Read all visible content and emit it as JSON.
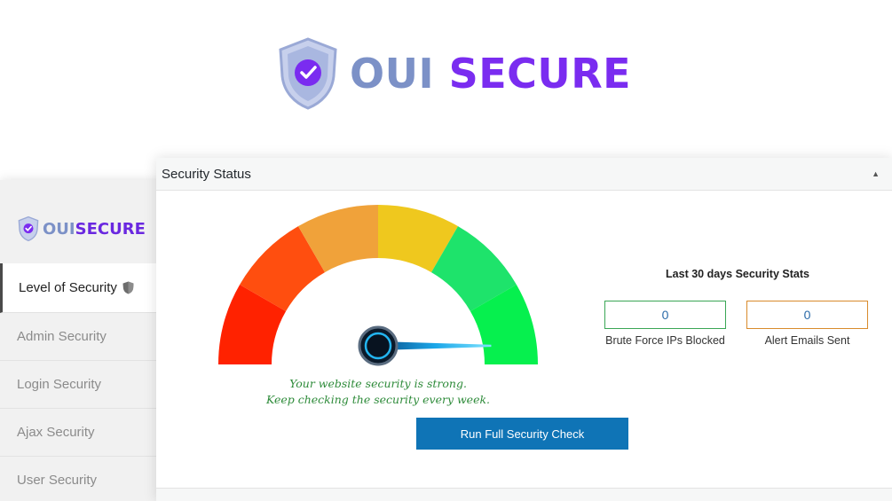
{
  "brand": {
    "name_part1": "OUI",
    "name_part2": "SECURE",
    "colors": {
      "oui": "#7c91c7",
      "secure": "#7a2cf0",
      "shield": "#b9c4e4"
    }
  },
  "sidebar": {
    "logo_part1": "OUI",
    "logo_part2": "SECURE",
    "items": [
      {
        "label": "Level of Security",
        "active": true,
        "icon": "shield-icon"
      },
      {
        "label": "Admin Security",
        "active": false
      },
      {
        "label": "Login Security",
        "active": false
      },
      {
        "label": "Ajax Security",
        "active": false
      },
      {
        "label": "User Security",
        "active": false
      }
    ]
  },
  "panel": {
    "title": "Security Status",
    "toggle_icon": "triangle-up-icon",
    "message_line1": "Your website security is strong.",
    "message_line2": "Keep checking the security every week.",
    "run_button": "Run Full Security Check",
    "colors": {
      "button": "#0f74b6",
      "message": "#2e8b3a"
    }
  },
  "gauge": {
    "segments": [
      "#ff2200",
      "#ff4e0f",
      "#f0a23a",
      "#efc81e",
      "#1ee36b",
      "#06f04e"
    ],
    "needle_level": 0.97,
    "needle_color": "#1aa6e8"
  },
  "stats": {
    "title": "Last 30 days Security Stats",
    "brute_force_value": "0",
    "brute_force_label": "Brute Force IPs Blocked",
    "alert_emails_value": "0",
    "alert_emails_label": "Alert Emails Sent",
    "colors": {
      "brute_border": "#3aa655",
      "alert_border": "#d98b2c",
      "value": "#2a6aa8"
    }
  }
}
